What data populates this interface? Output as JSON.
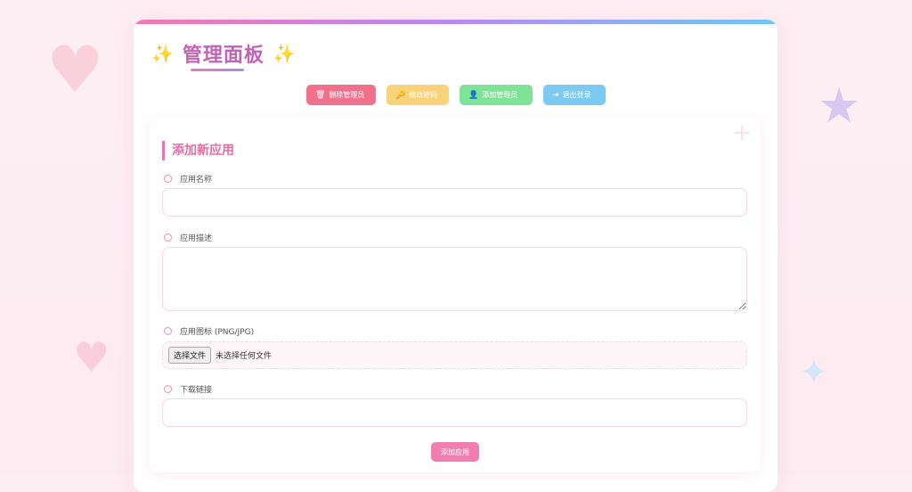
{
  "header": {
    "title": "管理面板"
  },
  "toolbar": {
    "delete_admin": "删除管理员",
    "change_password": "修改密码",
    "add_admin": "添加管理员",
    "logout": "退出登录"
  },
  "form": {
    "section_title": "添加新应用",
    "name_label": "应用名称",
    "name_value": "",
    "description_label": "应用描述",
    "description_value": "",
    "icon_label": "应用图标 (PNG/JPG)",
    "file_button": "选择文件",
    "file_status": "未选择任何文件",
    "download_label": "下载链接",
    "download_value": "",
    "submit_label": "添加应用"
  },
  "colors": {
    "accent_pink": "#f07eb0",
    "title_purple": "#c463b5",
    "delete_red": "#f1708c",
    "password_yellow": "#fad27a",
    "add_green": "#7ee396",
    "logout_blue": "#7cc9f2"
  },
  "icons": {
    "delete": "trash-icon",
    "password": "key-icon",
    "add": "user-plus-icon",
    "logout": "logout-icon",
    "title": "sparkle-icon"
  }
}
